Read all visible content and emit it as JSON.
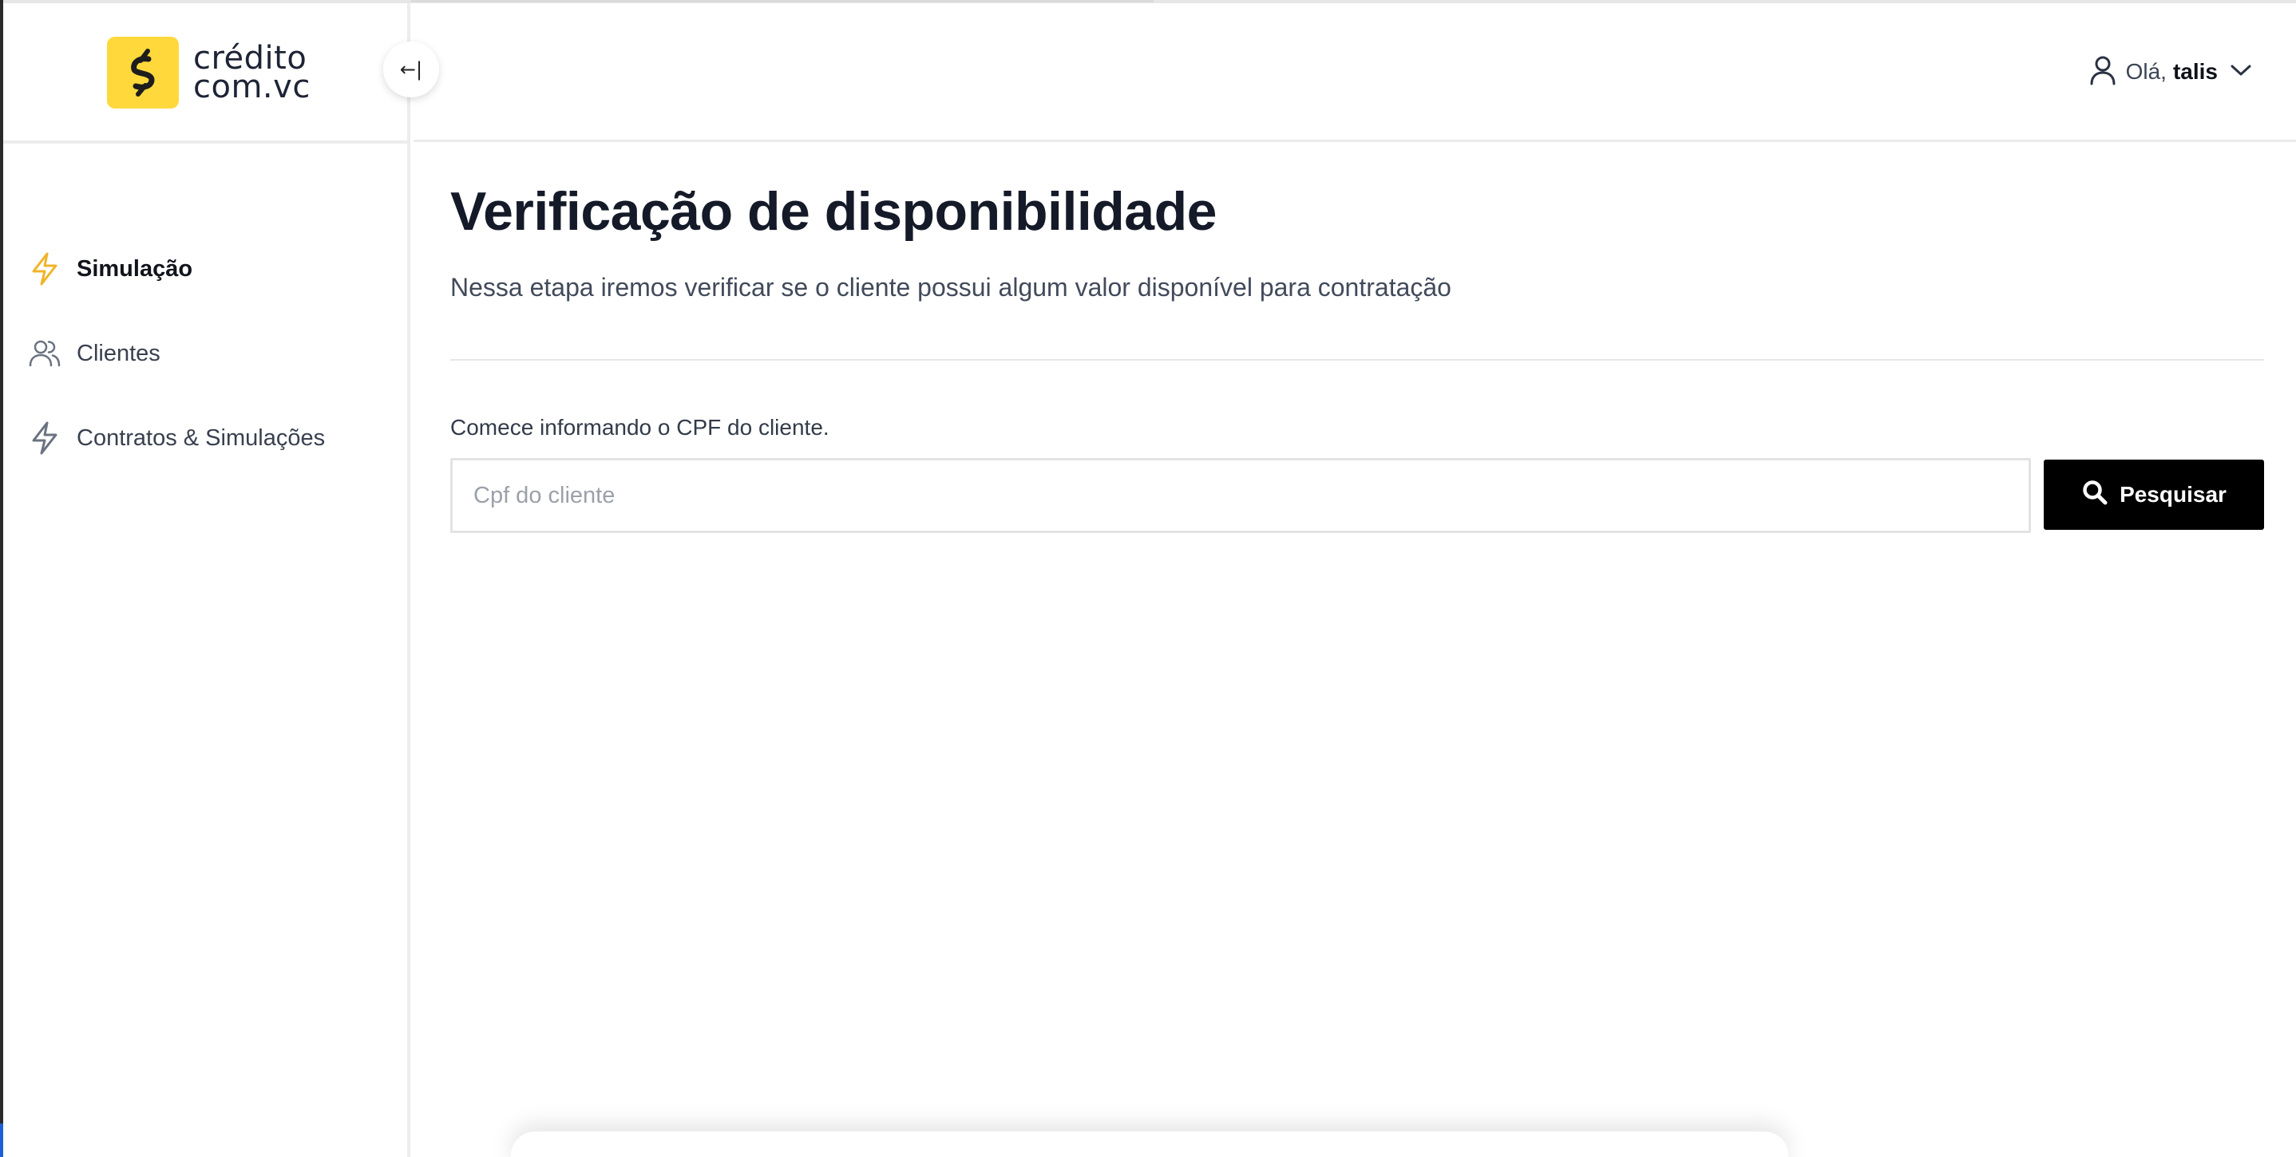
{
  "brand": {
    "name_line1": "crédito",
    "name_line2": "com.vc",
    "logo_color": "#ffd93b",
    "logo_icon": "dollar-s-icon"
  },
  "sidebar": {
    "collapse_icon": "collapse-left-icon",
    "collapse_glyph": "←|",
    "items": [
      {
        "label": "Simulação",
        "icon": "lightning-icon",
        "active": true,
        "accent": "#f0b429"
      },
      {
        "label": "Clientes",
        "icon": "users-icon",
        "active": false
      },
      {
        "label": "Contratos & Simulações",
        "icon": "lightning-icon",
        "active": false
      }
    ]
  },
  "header": {
    "greeting": "Olá,",
    "username": "talis",
    "user_icon": "user-icon",
    "menu_icon": "chevron-down-icon"
  },
  "main": {
    "title": "Verificação de disponibilidade",
    "subtitle": "Nessa etapa iremos verificar se o cliente possui algum valor disponível para contratação",
    "field_label": "Comece informando o CPF do cliente.",
    "cpf_input": {
      "value": "",
      "placeholder": "Cpf do cliente"
    },
    "search_button": {
      "label": "Pesquisar",
      "icon": "search-icon"
    }
  }
}
